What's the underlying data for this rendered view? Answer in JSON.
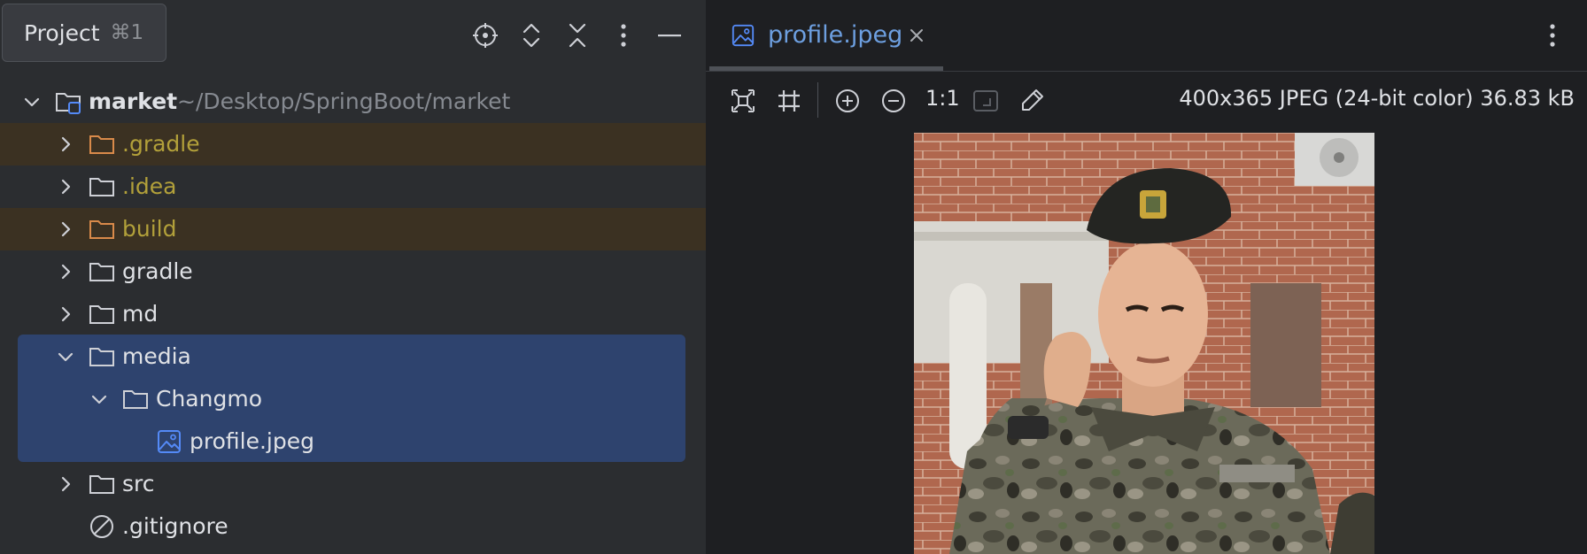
{
  "project_panel": {
    "title": "Project",
    "shortcut": "⌘1",
    "toolbar_icons": [
      "locate-icon",
      "expand-all-icon",
      "collapse-all-icon",
      "more-options-icon",
      "minimize-icon"
    ],
    "root": {
      "name": "market",
      "path": "~/Desktop/SpringBoot/market"
    },
    "items": [
      {
        "label": ".gradle",
        "type": "folder",
        "excluded": true,
        "expanded": false
      },
      {
        "label": ".idea",
        "type": "folder",
        "excluded": false,
        "expanded": false
      },
      {
        "label": "build",
        "type": "folder",
        "excluded": true,
        "expanded": false
      },
      {
        "label": "gradle",
        "type": "folder",
        "excluded": false,
        "expanded": false
      },
      {
        "label": "md",
        "type": "folder",
        "excluded": false,
        "expanded": false
      },
      {
        "label": "media",
        "type": "folder",
        "excluded": false,
        "expanded": true,
        "selected": true
      },
      {
        "label": "Changmo",
        "type": "folder",
        "excluded": false,
        "expanded": true,
        "selected": true
      },
      {
        "label": "profile.jpeg",
        "type": "image",
        "selected": true
      },
      {
        "label": "src",
        "type": "folder",
        "excluded": false,
        "expanded": false
      },
      {
        "label": ".gitignore",
        "type": "ignore-file"
      }
    ]
  },
  "editor": {
    "tab": {
      "label": "profile.jpeg",
      "close_icon": "close-icon"
    },
    "toolbar": {
      "icons": [
        "fit-to-window-icon",
        "grid-icon",
        "zoom-in-icon",
        "zoom-out-icon",
        "actual-size-icon",
        "color-picker-icon"
      ],
      "zoom_actual": "1:1",
      "image_info": "400x365 JPEG (24-bit color) 36.83 kB"
    }
  },
  "colors": {
    "accent_blue": "#548af7",
    "excluded_bg": "#3b3122",
    "excluded_text": "#b2a03a",
    "selection_bg": "#2e436e",
    "panel_bg": "#2b2d30",
    "editor_bg": "#1e1f22"
  }
}
